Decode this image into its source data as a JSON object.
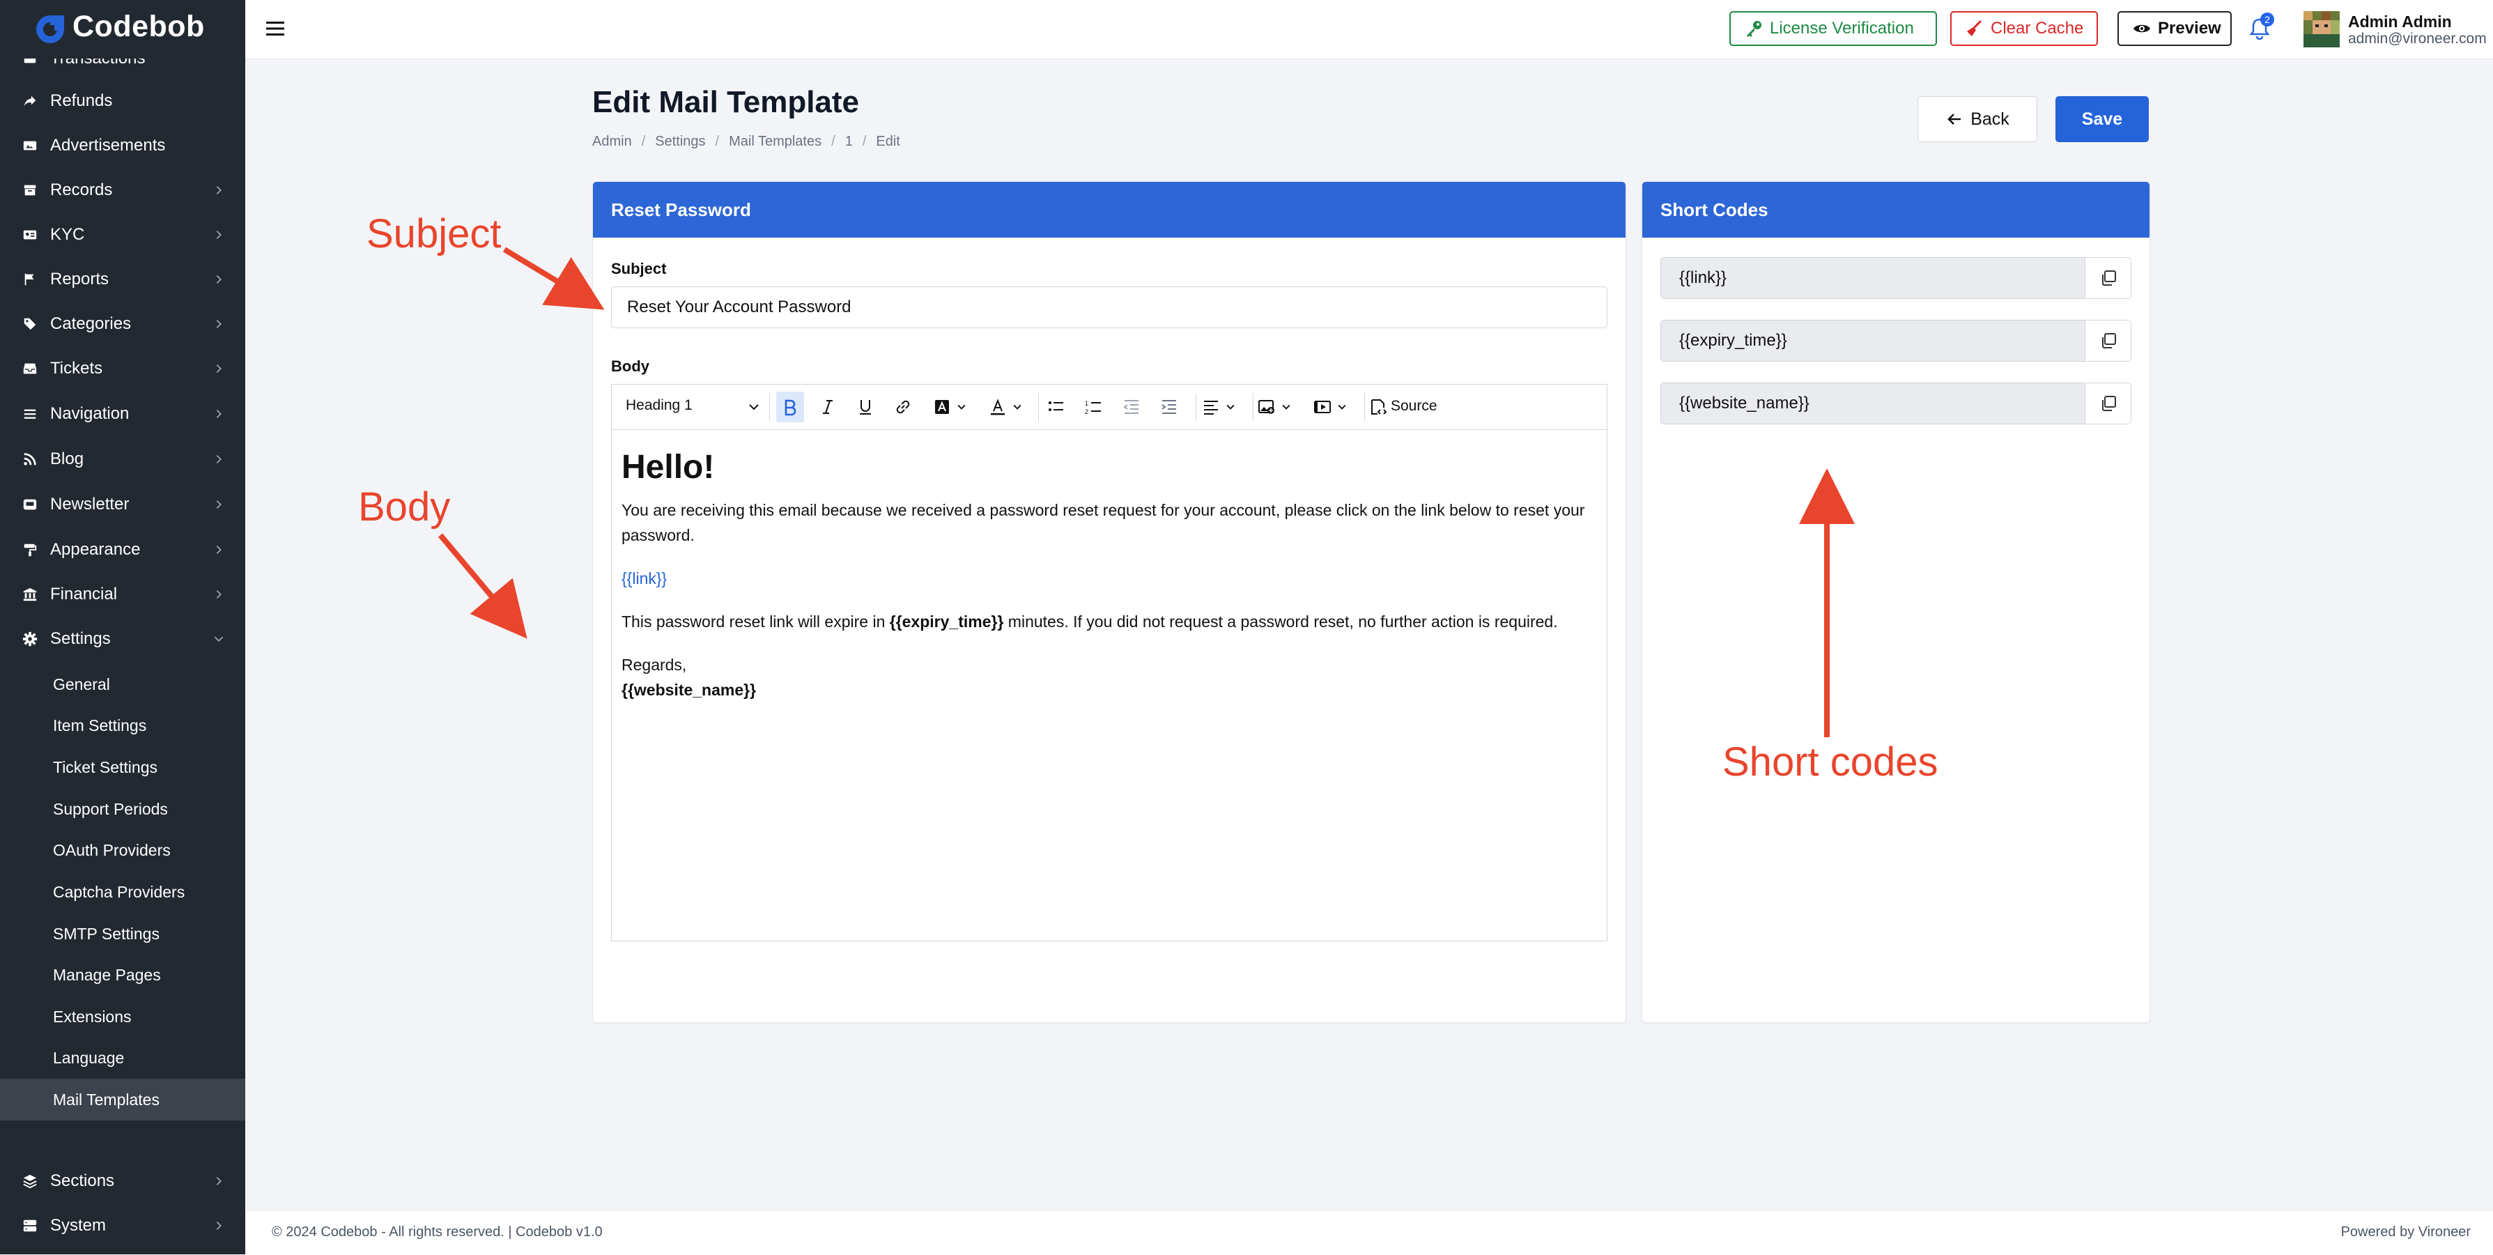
{
  "brand": {
    "name": "Codebob",
    "color": "#2563d9"
  },
  "sidebar": {
    "partial_top_item": "Transactions",
    "items": [
      {
        "label": "Refunds",
        "icon": "share-icon",
        "has_chevron": false
      },
      {
        "label": "Advertisements",
        "icon": "ad-icon",
        "has_chevron": false
      },
      {
        "label": "Records",
        "icon": "archive-icon",
        "has_chevron": true
      },
      {
        "label": "KYC",
        "icon": "id-card-icon",
        "has_chevron": true
      },
      {
        "label": "Reports",
        "icon": "flag-icon",
        "has_chevron": true
      },
      {
        "label": "Categories",
        "icon": "tags-icon",
        "has_chevron": true
      },
      {
        "label": "Tickets",
        "icon": "inbox-icon",
        "has_chevron": true
      },
      {
        "label": "Navigation",
        "icon": "bars-icon",
        "has_chevron": true
      },
      {
        "label": "Blog",
        "icon": "rss-icon",
        "has_chevron": true
      },
      {
        "label": "Newsletter",
        "icon": "envelope-icon",
        "has_chevron": true
      },
      {
        "label": "Appearance",
        "icon": "paint-roller-icon",
        "has_chevron": true
      },
      {
        "label": "Financial",
        "icon": "bank-icon",
        "has_chevron": true
      },
      {
        "label": "Settings",
        "icon": "gear-icon",
        "has_chevron": true,
        "expanded": true
      }
    ],
    "settings_subitems": [
      "General",
      "Item Settings",
      "Ticket Settings",
      "Support Periods",
      "OAuth Providers",
      "Captcha Providers",
      "SMTP Settings",
      "Manage Pages",
      "Extensions",
      "Language",
      "Mail Templates"
    ],
    "active_subitem": "Mail Templates",
    "bottom_items": [
      {
        "label": "Sections",
        "icon": "layers-icon"
      },
      {
        "label": "System",
        "icon": "server-icon"
      }
    ]
  },
  "topbar": {
    "license_label": "License Verification",
    "cache_label": "Clear Cache",
    "preview_label": "Preview",
    "notification_count": "2",
    "user_name": "Admin Admin",
    "user_email": "admin@vironeer.com"
  },
  "page": {
    "title": "Edit Mail Template",
    "breadcrumb": [
      "Admin",
      "Settings",
      "Mail Templates",
      "1",
      "Edit"
    ],
    "back_label": "Back",
    "save_label": "Save"
  },
  "template_card": {
    "title": "Reset Password",
    "subject_label": "Subject",
    "subject_value": "Reset Your Account Password",
    "body_label": "Body",
    "heading_select": "Heading 1",
    "source_label": "Source",
    "body": {
      "heading": "Hello!",
      "para1": "You are receiving this email because we received a password reset request for your account, please click on the link below to reset your password.",
      "link": "{{link}}",
      "para3_before": "This password reset link will expire in ",
      "para3_bold": "{{expiry_time}}",
      "para3_after": " minutes. If you did not request a password reset, no further action is required.",
      "regards": "Regards,",
      "signature": "{{website_name}}"
    }
  },
  "shortcodes_card": {
    "title": "Short Codes",
    "codes": [
      "{{link}}",
      "{{expiry_time}}",
      "{{website_name}}"
    ]
  },
  "annotations": {
    "subject": "Subject",
    "body": "Body",
    "short_codes": "Short codes",
    "color": "#e8452c"
  },
  "footer": {
    "left": "© 2024 Codebob - All rights reserved. | Codebob v1.0",
    "right": "Powered by Vironeer"
  }
}
